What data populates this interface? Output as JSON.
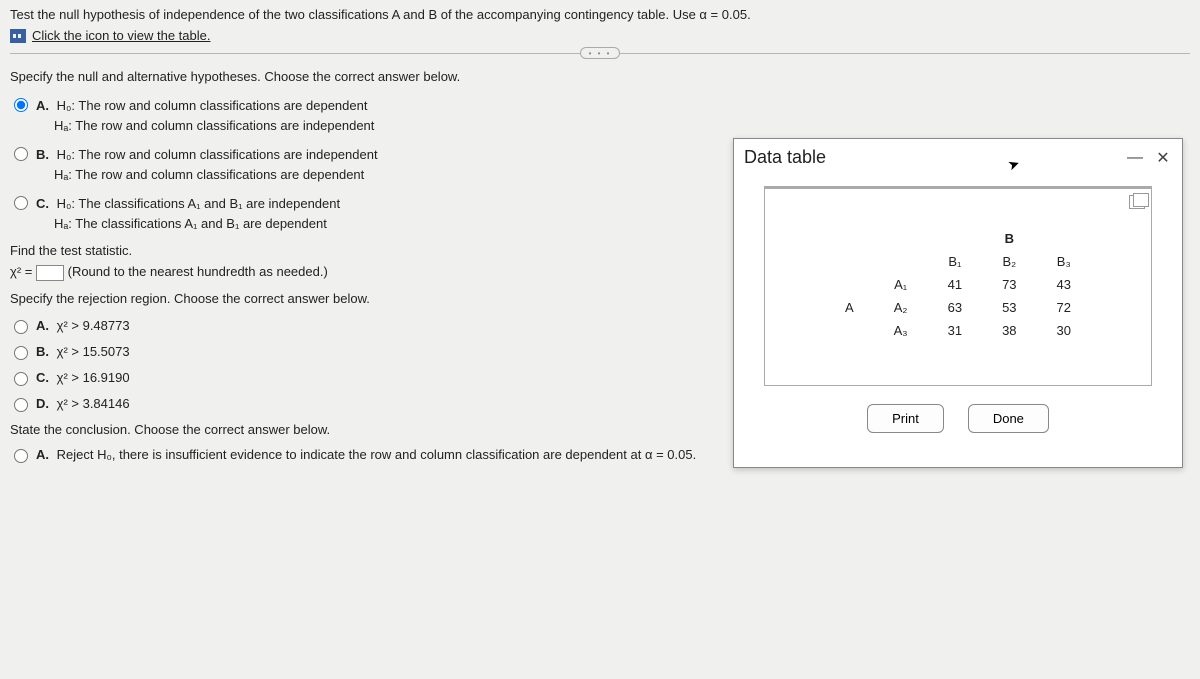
{
  "question": {
    "prompt": "Test the null hypothesis of independence of the two classifications A and B of the accompanying contingency table. Use α = 0.05.",
    "link": "Click the icon to view the table."
  },
  "hypotheses": {
    "heading": "Specify the null and alternative hypotheses. Choose the correct answer below.",
    "optA_l1": "H₀: The row and column classifications are dependent",
    "optA_l2": "Hₐ: The row and column classifications are independent",
    "optB_l1": "H₀: The row and column classifications are independent",
    "optB_l2": "Hₐ: The row and column classifications are dependent",
    "optC_l1": "H₀: The classifications A₁ and B₁ are independent",
    "optC_l2": "Hₐ: The classifications A₁ and B₁ are dependent"
  },
  "statistic": {
    "heading": "Find the test statistic.",
    "prefix": "χ² =",
    "hint": "(Round to the nearest hundredth as needed.)"
  },
  "region": {
    "heading": "Specify the rejection region. Choose the correct answer below.",
    "optA": "χ² > 9.48773",
    "optB": "χ² > 15.5073",
    "optC": "χ² > 16.9190",
    "optD": "χ² > 3.84146"
  },
  "conclusion": {
    "heading": "State the conclusion. Choose the correct answer below.",
    "optA": "Reject H₀, there is insufficient evidence to indicate the row and column classification are dependent at α = 0.05."
  },
  "modal": {
    "title": "Data table",
    "print": "Print",
    "done": "Done",
    "A": "A",
    "B": "B",
    "A1": "A₁",
    "A2": "A₂",
    "A3": "A₃",
    "B1": "B₁",
    "B2": "B₂",
    "B3": "B₃",
    "r1c1": "41",
    "r1c2": "73",
    "r1c3": "43",
    "r2c1": "63",
    "r2c2": "53",
    "r2c3": "72",
    "r3c1": "31",
    "r3c2": "38",
    "r3c3": "30"
  },
  "labels": {
    "A": "A.",
    "B": "B.",
    "C": "C.",
    "D": "D."
  }
}
